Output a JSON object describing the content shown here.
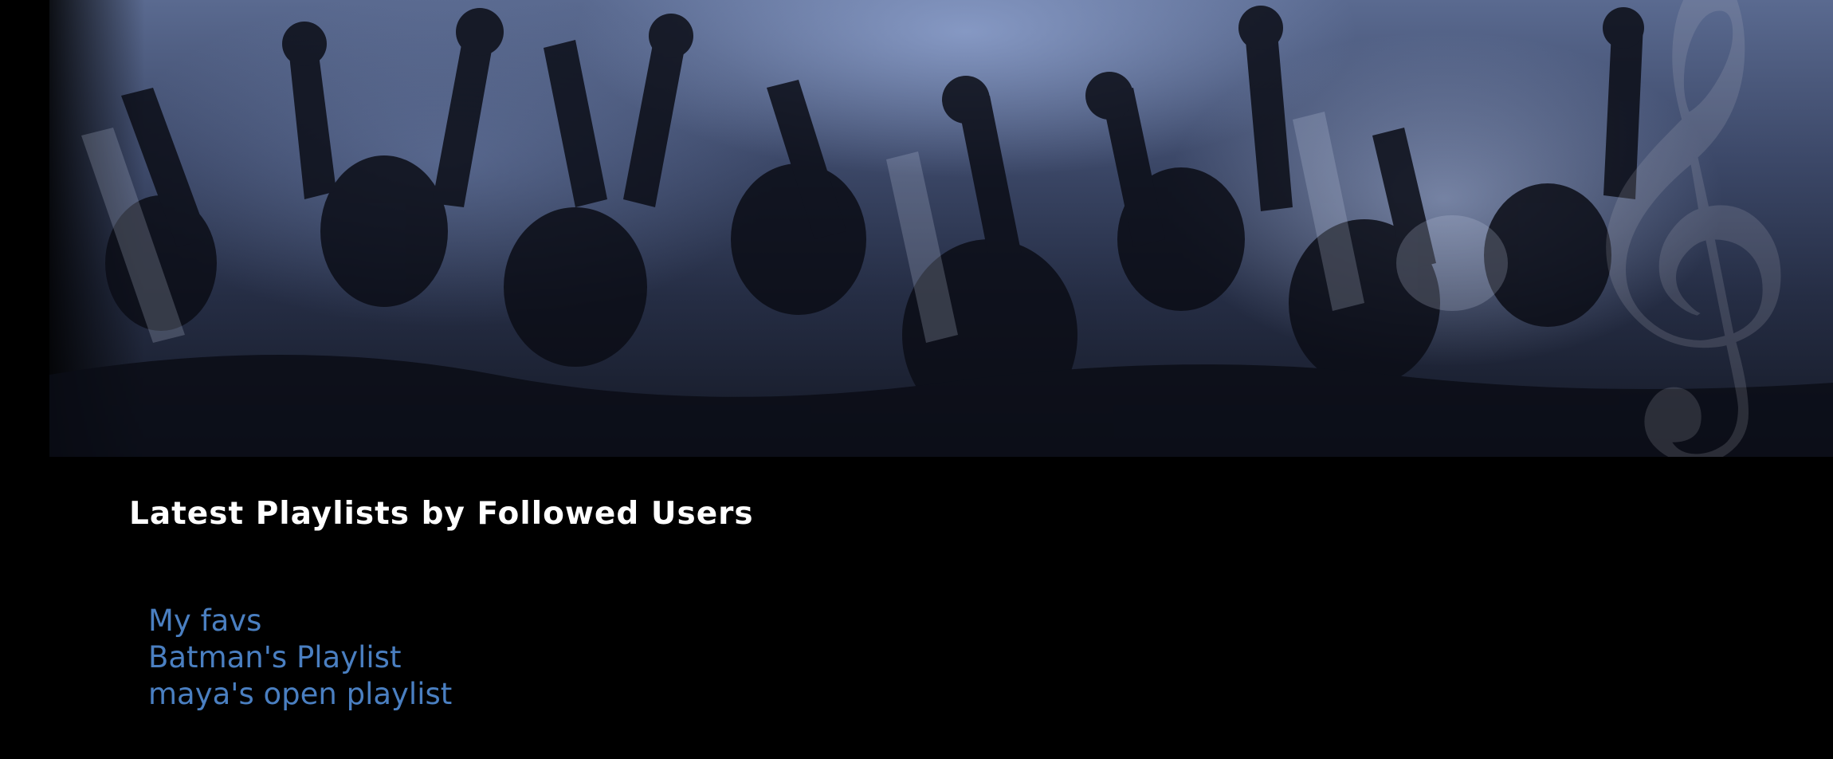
{
  "banner": {
    "icon": "treble-clef-icon",
    "image": "concert-crowd-with-raised-hands"
  },
  "section": {
    "title": "Latest Playlists by Followed Users"
  },
  "playlists": [
    {
      "name": "My favs"
    },
    {
      "name": "Batman's Playlist"
    },
    {
      "name": "maya's open playlist"
    }
  ],
  "colors": {
    "background": "#000000",
    "title": "#ffffff",
    "link": "#4a7fc1",
    "banner_tint": "#5a6a90"
  }
}
